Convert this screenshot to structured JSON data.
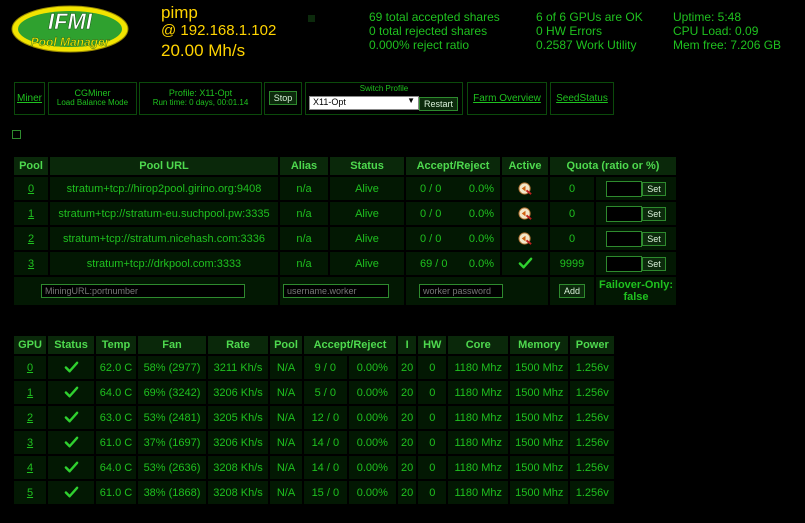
{
  "logo": {
    "line1": "IFMI",
    "line2": "Pool Manager"
  },
  "host": {
    "name": "pimp",
    "ip": "@ 192.168.1.102",
    "rate": "20.00 Mh/s"
  },
  "stats": {
    "col1": [
      "69 total accepted shares",
      "0 total rejected shares",
      "0.000% reject ratio"
    ],
    "col2": [
      "6 of 6 GPUs are OK",
      "0 HW Errors",
      "0.2587 Work Utility"
    ],
    "col3": [
      "Uptime: 5:48",
      "CPU Load: 0.09",
      "Mem free: 7.206 GB"
    ]
  },
  "toolbar": {
    "miner_link": "Miner",
    "miner_name": "CGMiner",
    "miner_mode": "Load Balance Mode",
    "profile_label": "Profile: X11-Opt",
    "runtime": "Run time: 0 days, 00:01.14",
    "stop": "Stop",
    "switch_label": "Switch Profile",
    "switch_value": "X11-Opt",
    "restart": "Restart",
    "farm_overview": "Farm Overview",
    "seed_status": "SeedStatus"
  },
  "pools": {
    "headers": [
      "Pool",
      "Pool URL",
      "Alias",
      "Status",
      "Accept/Reject",
      "Active",
      "Quota (ratio or %)"
    ],
    "rows": [
      {
        "id": "0",
        "url": "stratum+tcp://hirop2pool.girino.org:9408",
        "alias": "n/a",
        "status": "Alive",
        "ar": "0 / 0",
        "pct": "0.0%",
        "active": "switch",
        "quota": "0"
      },
      {
        "id": "1",
        "url": "stratum+tcp://stratum-eu.suchpool.pw:3335",
        "alias": "n/a",
        "status": "Alive",
        "ar": "0 / 0",
        "pct": "0.0%",
        "active": "switch",
        "quota": "0"
      },
      {
        "id": "2",
        "url": "stratum+tcp://stratum.nicehash.com:3336",
        "alias": "n/a",
        "status": "Alive",
        "ar": "0 / 0",
        "pct": "0.0%",
        "active": "switch",
        "quota": "0"
      },
      {
        "id": "3",
        "url": "stratum+tcp://drkpool.com:3333",
        "alias": "n/a",
        "status": "Alive",
        "ar": "69 / 0",
        "pct": "0.0%",
        "active": "check",
        "quota": "9999"
      }
    ],
    "set_label": "Set",
    "add_url_placeholder": "MiningURL:portnumber",
    "add_user_placeholder": "username.worker",
    "add_pass_placeholder": "worker password",
    "add_label": "Add",
    "failover_label": "Failover-Only:",
    "failover_value": "false"
  },
  "gpus": {
    "headers": [
      "GPU",
      "Status",
      "Temp",
      "Fan",
      "Rate",
      "Pool",
      "Accept/Reject",
      "I",
      "HW",
      "Core",
      "Memory",
      "Power"
    ],
    "rows": [
      {
        "id": "0",
        "temp": "62.0 C",
        "fan": "58% (2977)",
        "rate": "3211 Kh/s",
        "pool": "N/A",
        "ar": "9 / 0",
        "pct": "0.00%",
        "i": "20",
        "hw": "0",
        "core": "1180 Mhz",
        "mem": "1500 Mhz",
        "power": "1.256v"
      },
      {
        "id": "1",
        "temp": "64.0 C",
        "fan": "69% (3242)",
        "rate": "3206 Kh/s",
        "pool": "N/A",
        "ar": "5 / 0",
        "pct": "0.00%",
        "i": "20",
        "hw": "0",
        "core": "1180 Mhz",
        "mem": "1500 Mhz",
        "power": "1.256v"
      },
      {
        "id": "2",
        "temp": "63.0 C",
        "fan": "53% (2481)",
        "rate": "3205 Kh/s",
        "pool": "N/A",
        "ar": "12 / 0",
        "pct": "0.00%",
        "i": "20",
        "hw": "0",
        "core": "1180 Mhz",
        "mem": "1500 Mhz",
        "power": "1.256v"
      },
      {
        "id": "3",
        "temp": "61.0 C",
        "fan": "37% (1697)",
        "rate": "3206 Kh/s",
        "pool": "N/A",
        "ar": "14 / 0",
        "pct": "0.00%",
        "i": "20",
        "hw": "0",
        "core": "1180 Mhz",
        "mem": "1500 Mhz",
        "power": "1.256v"
      },
      {
        "id": "4",
        "temp": "64.0 C",
        "fan": "53% (2636)",
        "rate": "3208 Kh/s",
        "pool": "N/A",
        "ar": "14 / 0",
        "pct": "0.00%",
        "i": "20",
        "hw": "0",
        "core": "1180 Mhz",
        "mem": "1500 Mhz",
        "power": "1.256v"
      },
      {
        "id": "5",
        "temp": "61.0 C",
        "fan": "38% (1868)",
        "rate": "3208 Kh/s",
        "pool": "N/A",
        "ar": "15 / 0",
        "pct": "0.00%",
        "i": "20",
        "hw": "0",
        "core": "1180 Mhz",
        "mem": "1500 Mhz",
        "power": "1.256v"
      }
    ]
  },
  "colors": {
    "accent": "#1fc11f",
    "highlight": "#ffd400",
    "header_bg": "#0a280a",
    "cell_bg": "#031803"
  }
}
